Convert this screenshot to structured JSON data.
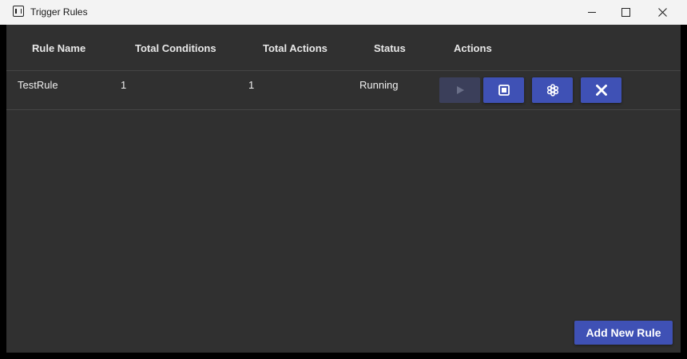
{
  "window": {
    "title": "Trigger Rules",
    "icon": "app-icon",
    "controls": [
      "minimize",
      "maximize",
      "close"
    ]
  },
  "table": {
    "columns": [
      "Rule Name",
      "Total Conditions",
      "Total Actions",
      "Status",
      "Actions"
    ],
    "rows": [
      {
        "name": "TestRule",
        "conditions": "1",
        "actions": "1",
        "status": "Running",
        "buttons": [
          {
            "icon": "play-icon",
            "enabled": false
          },
          {
            "icon": "stop-icon",
            "enabled": true
          },
          {
            "icon": "settings-icon",
            "enabled": true
          },
          {
            "icon": "delete-icon",
            "enabled": true
          }
        ]
      }
    ]
  },
  "footer": {
    "add_label": "Add New Rule"
  },
  "colors": {
    "background": "#303030",
    "accent": "#3f51b5",
    "accent_disabled": "#3b3f5a",
    "titlebar": "#f3f3f3"
  }
}
